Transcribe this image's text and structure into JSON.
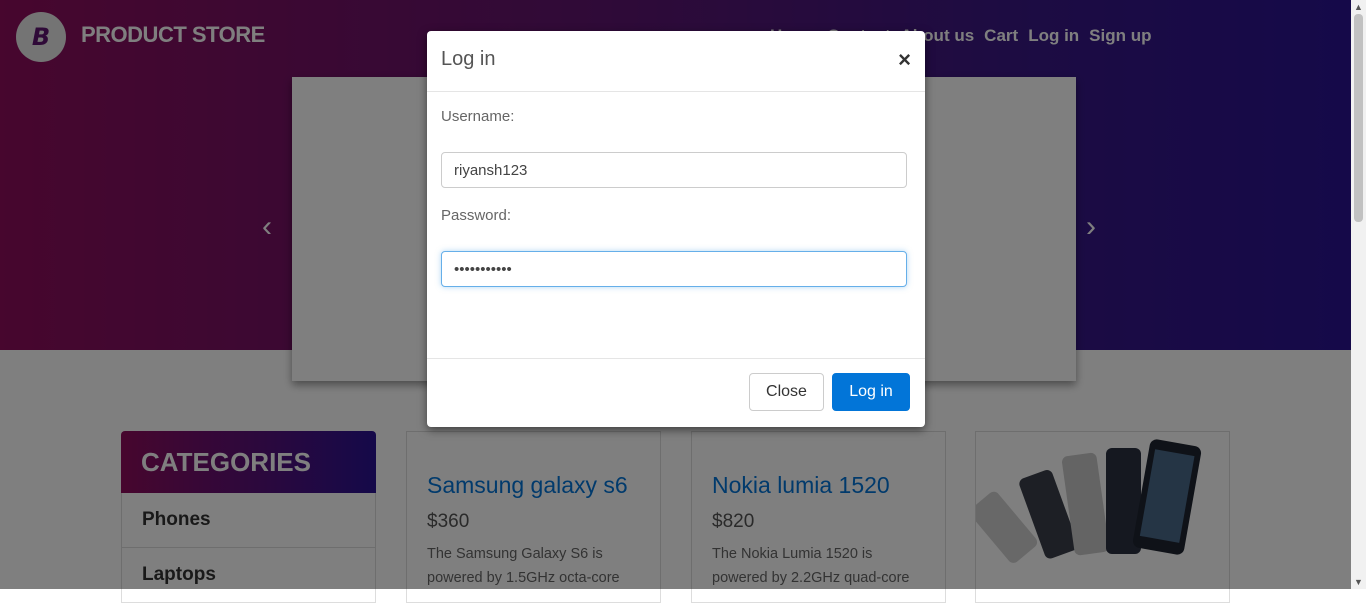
{
  "header": {
    "brand": "PRODUCT STORE",
    "logo_letter": "B",
    "nav": [
      "Home",
      "Contact",
      "About us",
      "Cart",
      "Log in",
      "Sign up"
    ]
  },
  "carousel": {
    "prev": "‹",
    "next": "›"
  },
  "categories": {
    "title": "CATEGORIES",
    "items": [
      "Phones",
      "Laptops"
    ]
  },
  "products": [
    {
      "title": "Samsung galaxy s6",
      "price": "$360",
      "desc": "The Samsung Galaxy S6 is powered by 1.5GHz octa-core"
    },
    {
      "title": "Nokia lumia 1520",
      "price": "$820",
      "desc": "The Nokia Lumia 1520 is powered by 2.2GHz quad-core"
    }
  ],
  "modal": {
    "title": "Log in",
    "close_icon": "×",
    "username_label": "Username:",
    "username_value": "riyansh123",
    "password_label": "Password:",
    "password_value": "•••••••••••",
    "close_button": "Close",
    "login_button": "Log in"
  }
}
